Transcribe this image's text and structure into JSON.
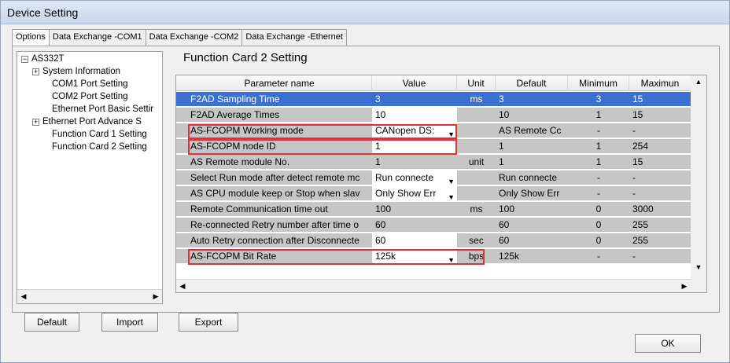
{
  "window": {
    "title": "Device Setting"
  },
  "tabs": [
    "Options",
    "Data Exchange -COM1",
    "Data Exchange -COM2",
    "Data Exchange -Ethernet"
  ],
  "tree": {
    "root": "AS332T",
    "items": [
      "System Information",
      "COM1 Port Setting",
      "COM2 Port Setting",
      "Ethernet Port Basic Settir",
      "Ethernet Port Advance S",
      "Function Card 1 Setting",
      "Function Card 2 Setting"
    ]
  },
  "section_title": "Function Card 2 Setting",
  "table": {
    "headers": [
      "Parameter name",
      "Value",
      "Unit",
      "Default",
      "Minimum",
      "Maximun"
    ],
    "rows": [
      {
        "name": "F2AD Sampling Time",
        "value": "3",
        "unit": "ms",
        "default": "3",
        "min": "3",
        "max": "15"
      },
      {
        "name": "F2AD Average Times",
        "value": "10",
        "unit": "",
        "default": "10",
        "min": "1",
        "max": "15"
      },
      {
        "name": "AS-FCOPM Working mode",
        "value": "CANopen DS:",
        "unit": "",
        "default": "AS Remote Cc",
        "min": "-",
        "max": "-"
      },
      {
        "name": "AS-FCOPM node ID",
        "value": "1",
        "unit": "",
        "default": "1",
        "min": "1",
        "max": "254"
      },
      {
        "name": "AS Remote module No.",
        "value": "1",
        "unit": "unit",
        "default": "1",
        "min": "1",
        "max": "15"
      },
      {
        "name": "Select Run mode after detect remote mc",
        "value": "Run connecte",
        "unit": "",
        "default": "Run connecte",
        "min": "-",
        "max": "-"
      },
      {
        "name": "AS CPU module keep or Stop when slav",
        "value": "Only Show Err",
        "unit": "",
        "default": "Only Show Err",
        "min": "-",
        "max": "-"
      },
      {
        "name": "Remote Communication time out",
        "value": "100",
        "unit": "ms",
        "default": "100",
        "min": "0",
        "max": "3000"
      },
      {
        "name": "Re-connected Retry number after time o",
        "value": "60",
        "unit": "",
        "default": "60",
        "min": "0",
        "max": "255"
      },
      {
        "name": "Auto Retry connection after Disconnecte",
        "value": "60",
        "unit": "sec",
        "default": "60",
        "min": "0",
        "max": "255"
      },
      {
        "name": "AS-FCOPM Bit Rate",
        "value": "125k",
        "unit": "bps",
        "default": "125k",
        "min": "-",
        "max": "-"
      }
    ]
  },
  "buttons": {
    "default": "Default",
    "import": "Import",
    "export": "Export",
    "ok": "OK"
  },
  "colors": {
    "selection": "#3b6fd1",
    "highlight_box": "#e0303a",
    "readonly_row": "#c6c6c6"
  }
}
